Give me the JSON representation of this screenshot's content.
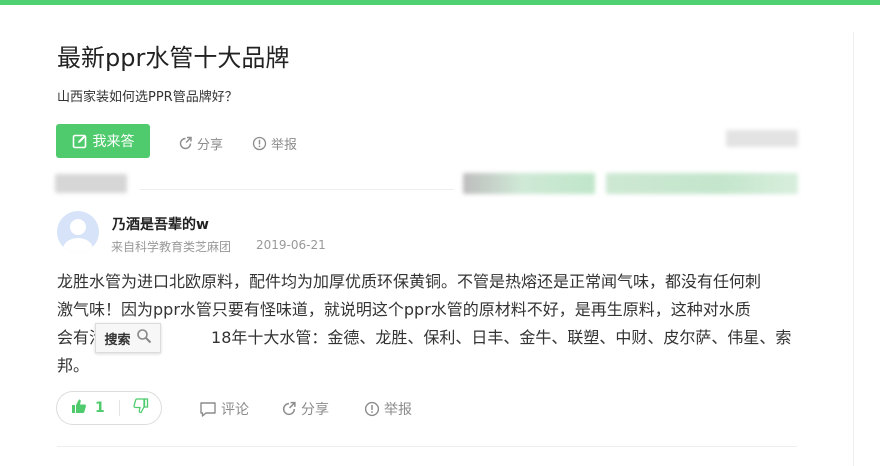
{
  "question": {
    "title": "最新ppr水管十大品牌",
    "description": "山西家装如何选PPR管品牌好？",
    "answer_button": "我来答",
    "share": "分享",
    "report": "举报"
  },
  "answer": {
    "username": "乃酒是吾辈的w",
    "source": "来自科学教育类芝麻团",
    "date": "2019-06-21",
    "content_lines": [
      "龙胜水管为进口北欧原料，配件均为加厚优质环保黄铜。不管是热熔还是正常闻气味，都没有任何刺",
      "激气味！因为ppr水管只要有怪味道，就说明这个ppr水管的原材料不好，是再生原料，这种对水质",
      "会有污",
      "18年十大水管：金德、龙胜、保利、日丰、金牛、联塑、中财、皮尔萨、伟星、索",
      "邦。"
    ],
    "search_popup": "搜索",
    "likes": "1",
    "comment": "评论",
    "share": "分享",
    "report": "举报"
  },
  "colors": {
    "brand_green": "#4fcb6e",
    "top_bar": "#4fd172",
    "muted_text": "#8c8c8c"
  },
  "icons": [
    "pencil-icon",
    "share-icon",
    "report-icon",
    "search-icon",
    "thumbs-up-icon",
    "thumbs-down-icon",
    "comment-icon"
  ]
}
